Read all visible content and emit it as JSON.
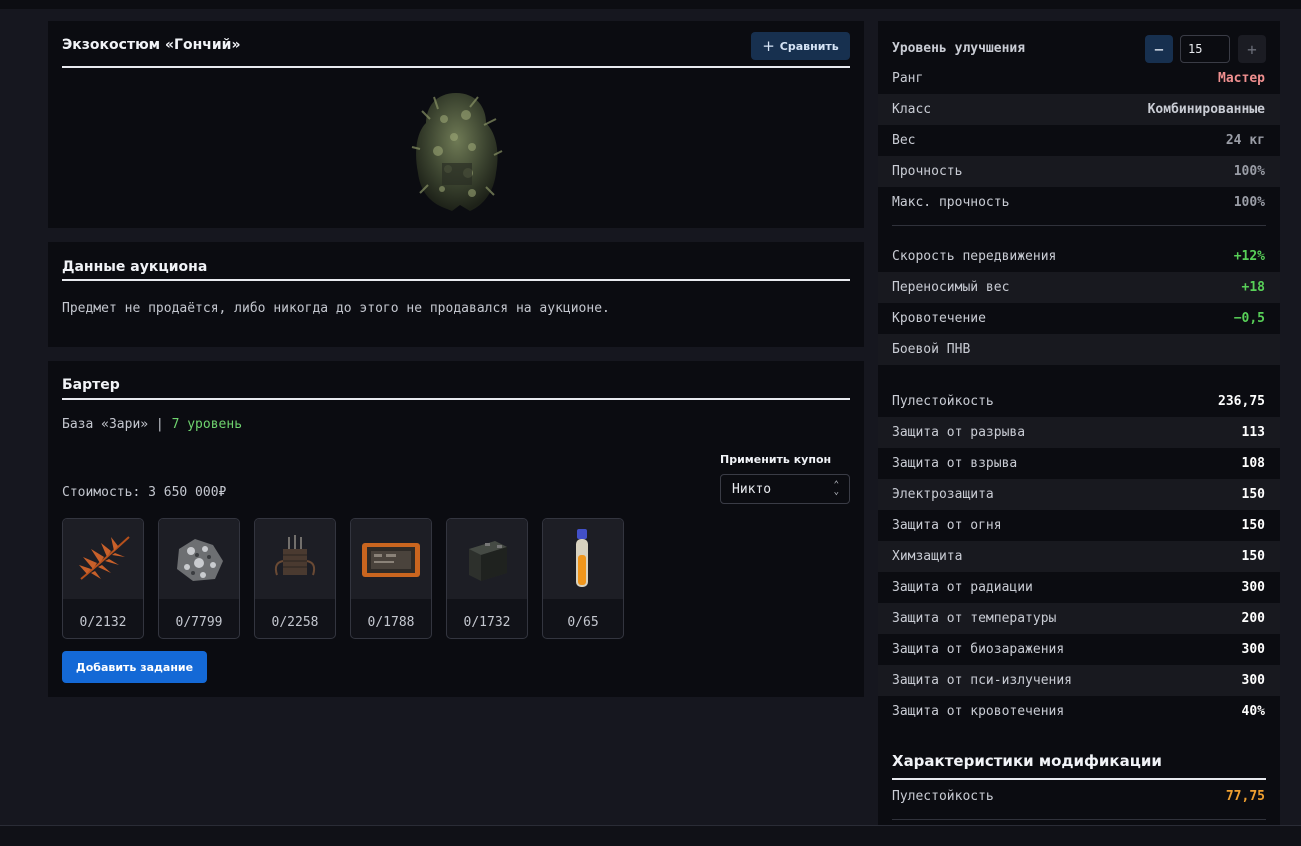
{
  "item": {
    "title": "Экзокостюм «Гончий»",
    "compare_label": "Сравнить"
  },
  "auction": {
    "title": "Данные аукциона",
    "message": "Предмет не продаётся, либо никогда до этого не продавался на аукционе."
  },
  "barter": {
    "title": "Бартер",
    "base": "База «Зари»",
    "separator": "|",
    "level": "7 уровень",
    "coupon_label": "Применить купон",
    "coupon_value": "Никто",
    "cost": "Стоимость: 3 650 000₽",
    "items": [
      {
        "icon": "fern-leaf-icon",
        "count": "0/2132"
      },
      {
        "icon": "mineral-rock-icon",
        "count": "0/7799"
      },
      {
        "icon": "electronic-device-icon",
        "count": "0/2258"
      },
      {
        "icon": "tablet-device-icon",
        "count": "0/1788"
      },
      {
        "icon": "battery-box-icon",
        "count": "0/1732"
      },
      {
        "icon": "vial-icon",
        "count": "0/65"
      }
    ],
    "add_task_label": "Добавить задание"
  },
  "stats": {
    "upgrade_label": "Уровень улучшения",
    "upgrade_level": "15",
    "minus": "−",
    "plus": "+",
    "general": [
      {
        "name": "Ранг",
        "value": "Мастер",
        "color": "#ef8f8f"
      },
      {
        "name": "Класс",
        "value": "Комбинированные",
        "color": "#c9ccd4"
      },
      {
        "name": "Вес",
        "value": "24 кг",
        "color": "#9a9da6"
      },
      {
        "name": "Прочность",
        "value": "100%",
        "color": "#9a9da6"
      },
      {
        "name": "Макс. прочность",
        "value": "100%",
        "color": "#9a9da6"
      }
    ],
    "effects": [
      {
        "name": "Скорость передвижения",
        "value": "+12%",
        "color": "#58d058"
      },
      {
        "name": "Переносимый вес",
        "value": "+18",
        "color": "#58d058"
      },
      {
        "name": "Кровотечение",
        "value": "−0,5",
        "color": "#58d058"
      },
      {
        "name": "Боевой ПНВ",
        "value": "",
        "color": "#c9ccd4"
      }
    ],
    "protection": [
      {
        "name": "Пулестойкость",
        "value": "236,75",
        "color": "#ffffff"
      },
      {
        "name": "Защита от разрыва",
        "value": "113",
        "color": "#ffffff"
      },
      {
        "name": "Защита от взрыва",
        "value": "108",
        "color": "#ffffff"
      },
      {
        "name": "Электрозащита",
        "value": "150",
        "color": "#ffffff"
      },
      {
        "name": "Защита от огня",
        "value": "150",
        "color": "#ffffff"
      },
      {
        "name": "Химзащита",
        "value": "150",
        "color": "#ffffff"
      },
      {
        "name": "Защита от радиации",
        "value": "300",
        "color": "#ffffff"
      },
      {
        "name": "Защита от температуры",
        "value": "200",
        "color": "#ffffff"
      },
      {
        "name": "Защита от биозаражения",
        "value": "300",
        "color": "#ffffff"
      },
      {
        "name": "Защита от пси-излучения",
        "value": "300",
        "color": "#ffffff"
      },
      {
        "name": "Защита от кровотечения",
        "value": "40%",
        "color": "#ffffff"
      }
    ],
    "mod_title": "Характеристики модификации",
    "mod": [
      {
        "name": "Пулестойкость",
        "value": "77,75",
        "color": "#f0a030"
      }
    ]
  }
}
